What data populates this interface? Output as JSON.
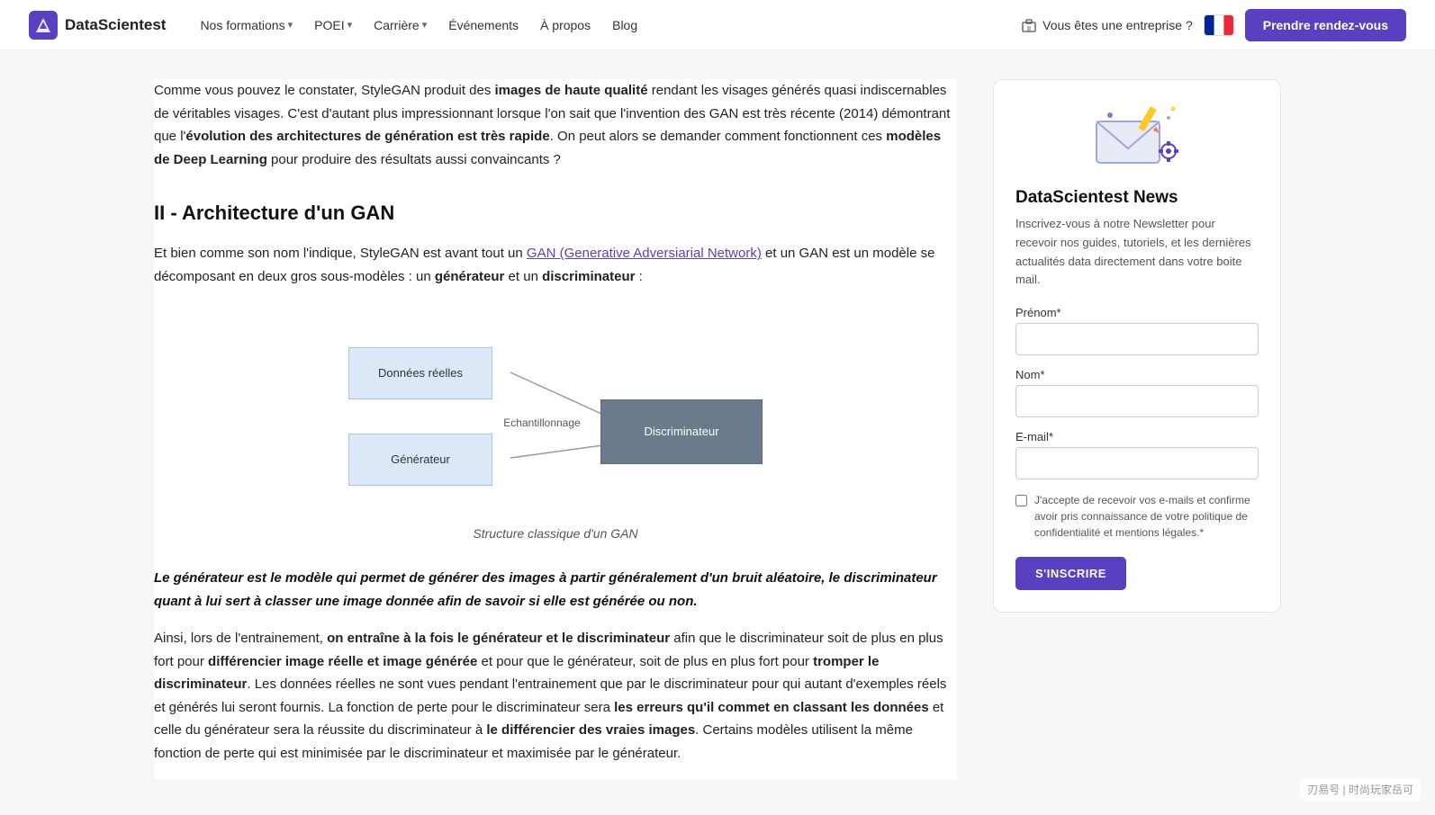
{
  "navbar": {
    "logo_text": "DataScientest",
    "nav_items": [
      {
        "label": "Nos formations",
        "has_dropdown": true
      },
      {
        "label": "POEI",
        "has_dropdown": true
      },
      {
        "label": "Carrière",
        "has_dropdown": true
      },
      {
        "label": "Événements",
        "has_dropdown": false
      },
      {
        "label": "À propos",
        "has_dropdown": false
      },
      {
        "label": "Blog",
        "has_dropdown": false
      }
    ],
    "enterprise_label": "Vous êtes une entreprise ?",
    "cta_label": "Prendre rendez-vous"
  },
  "article": {
    "intro_paragraph": "Comme vous pouvez le constater, StyleGAN produit des ",
    "intro_bold1": "images de haute qualité",
    "intro_rest": " rendant les visages générés quasi indiscernables de véritables visages. C'est d'autant plus impressionnant lorsque l'on sait que l'invention des GAN est très récente (2014) démontrant que l'",
    "intro_bold2": "évolution des architectures de génération est très rapide",
    "intro_rest2": ". On peut alors se demander comment fonctionnent ces ",
    "intro_bold3": "modèles de Deep Learning",
    "intro_rest3": " pour produire des résultats aussi convaincants ?",
    "section_title": "II - Architecture d'un GAN",
    "section_intro": "Et bien comme son nom l'indique, StyleGAN est avant tout un ",
    "section_link": "GAN (Generative Adversiarial Network)",
    "section_intro2": " et un GAN est un modèle se décomposant en deux gros sous-modèles : un ",
    "section_bold1": "générateur",
    "section_intro3": " et un ",
    "section_bold2": "discriminateur",
    "section_intro4": " :",
    "diagram": {
      "box_donnees": "Données réelles",
      "box_generateur": "Générateur",
      "box_discriminateur": "Discriminateur",
      "arrow_label": "Echantillonnage"
    },
    "figure_caption": "Structure classique d'un GAN",
    "blockquote": "Le générateur est le modèle qui permet de générer des images à partir généralement d'un bruit aléatoire, le discriminateur quant à lui sert à classer une image donnée afin de savoir si elle est générée ou non.",
    "paragraph2_start": "Ainsi, lors de l'entrainement, ",
    "paragraph2_bold1": "on entraîne à la fois le générateur et le discriminateur",
    "paragraph2_rest1": " afin que le discriminateur soit de plus en plus fort pour ",
    "paragraph2_bold2": "différencier image réelle et image générée",
    "paragraph2_rest2": " et pour que le générateur, soit de plus en plus fort pour ",
    "paragraph2_bold3": "tromper le discriminateur",
    "paragraph2_rest3": ". Les données réelles ne sont vues pendant l'entrainement que par le discriminateur pour qui autant d'exemples réels et générés lui seront fournis. La fonction de perte pour le discriminateur sera ",
    "paragraph2_bold4": "les erreurs qu'il commet en classant les données",
    "paragraph2_rest4": " et celle du générateur sera la réussite du discriminateur à ",
    "paragraph2_bold5": "le différencier des vraies images",
    "paragraph2_rest5": ". Certains modèles utilisent la même fonction de perte qui est minimisée par le discriminateur et maximisée par le générateur."
  },
  "sidebar": {
    "newsletter_title": "DataScientest News",
    "newsletter_desc": "Inscrivez-vous à notre Newsletter pour recevoir nos guides, tutoriels, et les dernières actualités data directement dans votre boite mail.",
    "form": {
      "prenom_label": "Prénom*",
      "prenom_placeholder": "",
      "nom_label": "Nom*",
      "nom_placeholder": "",
      "email_label": "E-mail*",
      "email_placeholder": "",
      "checkbox_label": "J'accepte de recevoir vos e-mails et confirme avoir pris connaissance de votre politique de confidentialité et mentions légales.*",
      "submit_label": "S'INSCRIRE"
    }
  },
  "watermark": "刃易号 | 时尚玩家岳可"
}
